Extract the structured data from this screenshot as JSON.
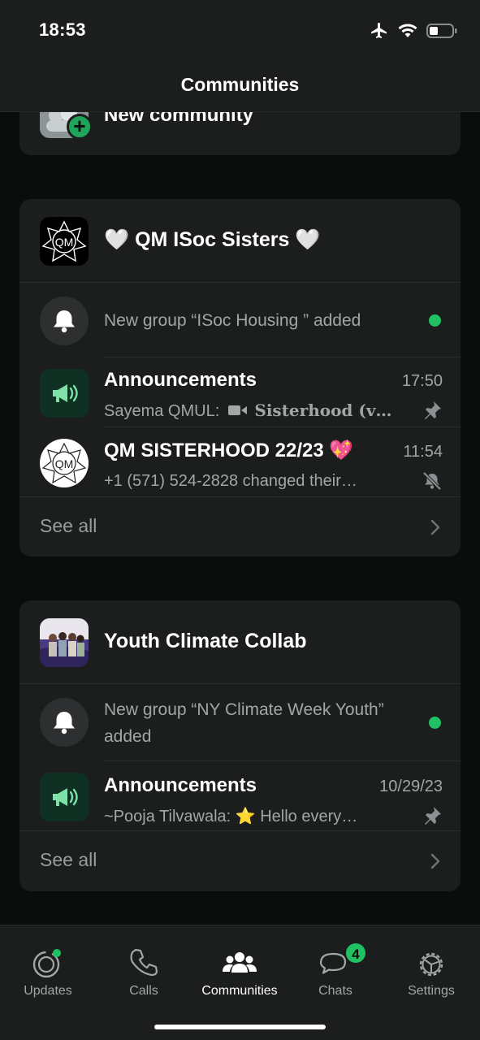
{
  "status_bar": {
    "time": "18:53"
  },
  "header": {
    "title": "Communities"
  },
  "new_community": {
    "label": "New community"
  },
  "communities": [
    {
      "name": "🤍 QM ISoc Sisters 🤍",
      "notice": "New group “ISoc Housing ” added",
      "groups": [
        {
          "title": "Announcements",
          "time": "17:50",
          "sender": "Sayema QMUL:",
          "preview": "Sisterhood (v…",
          "status_icon": "pin-icon"
        },
        {
          "title": "QM SISTERHOOD 22/23 💖",
          "time": "11:54",
          "preview": "+1 (571) 524-2828 changed their…",
          "status_icon": "muted-bell-icon"
        }
      ],
      "see_all": "See all"
    },
    {
      "name": "Youth Climate Collab",
      "notice": "New group “NY Climate Week Youth” added",
      "groups": [
        {
          "title": "Announcements",
          "time": "10/29/23",
          "sender": "~Pooja Tilvawala:",
          "preview": "⭐ Hello every…",
          "status_icon": "pin-icon"
        }
      ],
      "see_all": "See all"
    }
  ],
  "tabs": [
    {
      "label": "Updates"
    },
    {
      "label": "Calls"
    },
    {
      "label": "Communities"
    },
    {
      "label": "Chats",
      "badge": "4"
    },
    {
      "label": "Settings"
    }
  ],
  "colors": {
    "accent": "#21c063",
    "card": "#1c1e1e",
    "background": "#0b0c0c",
    "secondary_text": "#a3a6a7"
  }
}
